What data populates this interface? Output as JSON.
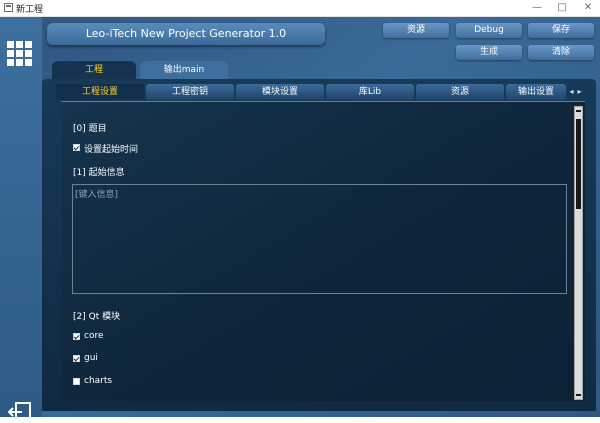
{
  "window": {
    "title": "新工程",
    "controls": {
      "minimize": "—",
      "maximize": "□",
      "close": "✕"
    }
  },
  "app": {
    "title": "Leo-iTech New Project Generator 1.0"
  },
  "toolbar": {
    "resources": "资源",
    "debug": "Debug",
    "save": "保存",
    "generate": "生成",
    "clear": "清除"
  },
  "outer_tabs": [
    {
      "label": "工程",
      "active": true
    },
    {
      "label": "输出main",
      "active": false
    }
  ],
  "inner_tabs": [
    {
      "label": "工程设置",
      "active": true
    },
    {
      "label": "工程密钥",
      "active": false
    },
    {
      "label": "模块设置",
      "active": false
    },
    {
      "label": "库Lib",
      "active": false
    },
    {
      "label": "资源",
      "active": false
    },
    {
      "label": "输出设置",
      "active": false
    }
  ],
  "tab_scroll": {
    "left": "◂",
    "right": "▸"
  },
  "settings": {
    "section0_title": "[0] 题目",
    "set_start_time": {
      "label": "设置起始时间",
      "checked": true
    },
    "section1_title": "[1] 起始信息",
    "start_info_placeholder": "[键入信息]",
    "section2_title": "[2] Qt 模块",
    "qt_modules": [
      {
        "label": "core",
        "checked": true
      },
      {
        "label": "gui",
        "checked": true
      },
      {
        "label": "charts",
        "checked": false
      }
    ]
  },
  "colors": {
    "active_tab_text": "#ffd233",
    "panel_bg": "#12304b",
    "main_bg": "#3a6a97"
  },
  "icons": {
    "menu": "grid-menu-icon",
    "exit": "exit-icon"
  }
}
